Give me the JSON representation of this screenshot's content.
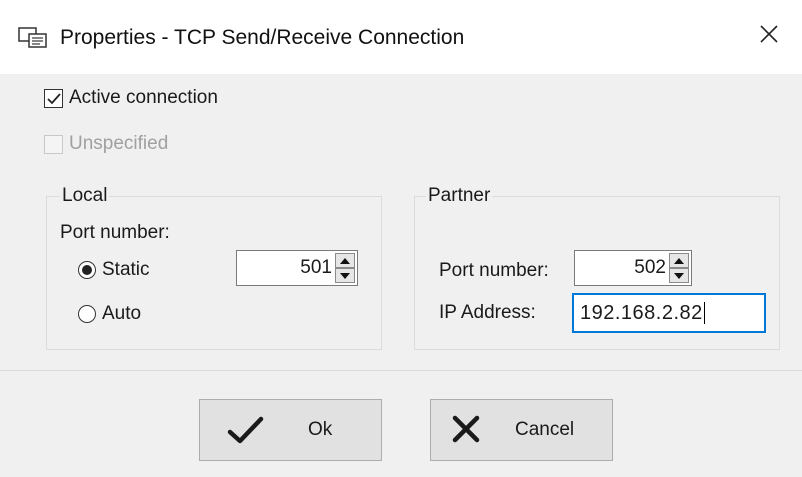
{
  "window": {
    "title": "Properties - TCP Send/Receive Connection",
    "title_icon": "properties-window-icon",
    "close_icon": "close-icon"
  },
  "options": {
    "active_connection": {
      "label": "Active connection",
      "checked": true
    },
    "unspecified": {
      "label": "Unspecified",
      "checked": false,
      "disabled": true
    }
  },
  "local": {
    "group_label": "Local",
    "port_label": "Port number:",
    "static_label": "Static",
    "auto_label": "Auto",
    "mode_selected": "Static",
    "port_value": "501"
  },
  "partner": {
    "group_label": "Partner",
    "port_label": "Port number:",
    "port_value": "502",
    "ip_label": "IP Address:",
    "ip_value": "192.168.2.82"
  },
  "buttons": {
    "ok_label": "Ok",
    "ok_icon": "checkmark-icon",
    "cancel_label": "Cancel",
    "cancel_icon": "x-icon"
  },
  "colors": {
    "focus_border": "#0078d7",
    "dialog_background": "#f0f0f0",
    "button_face": "#e1e1e1"
  }
}
